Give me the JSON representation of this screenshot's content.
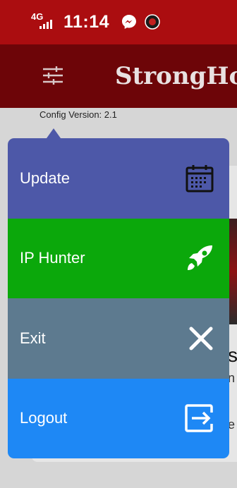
{
  "status_bar": {
    "network": "4G",
    "time": "11:14",
    "background_color": "#ab0d10"
  },
  "app_bar": {
    "title": "StrongHo",
    "menu_icon": "tune-icon",
    "background_color": "#6d0508"
  },
  "config_version": "Config Version: 2.1",
  "menu": {
    "items": [
      {
        "label": "Update",
        "icon": "calendar-icon",
        "color": "#4d58a8"
      },
      {
        "label": "IP Hunter",
        "icon": "rocket-icon",
        "color": "#0ba80b"
      },
      {
        "label": "Exit",
        "icon": "close-icon",
        "color": "#5d7a8f"
      },
      {
        "label": "Logout",
        "icon": "logout-icon",
        "color": "#1e88f5"
      }
    ]
  },
  "background_peek": {
    "text1": "s",
    "text2": "n",
    "text3": "e"
  }
}
